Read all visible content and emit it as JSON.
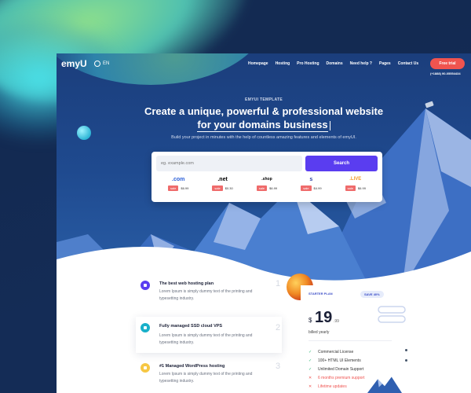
{
  "brand": {
    "logo": "emyU",
    "lang": "EN"
  },
  "nav": {
    "items": [
      "Homepage",
      "Hosting",
      "Pro Hosting",
      "Domains",
      "Need help ?",
      "Pages",
      "Contact Us"
    ],
    "cta": "Free trial",
    "phone": "(+1888) 90-05554434"
  },
  "hero": {
    "eyebrow": "EMYUI TEMPLATE",
    "title_line1": "Create a unique, powerful & professional website",
    "title_line2": "for your domains business",
    "subtitle": "Build your project in minutes with the help of countless amazing features and elements of emyUI."
  },
  "search": {
    "placeholder": "eg. example.com",
    "button": "Search",
    "tlds": [
      {
        "name": ".com",
        "sale": "sale",
        "price": "$6.99",
        "color": "#2b5fd9"
      },
      {
        "name": ".net",
        "sale": "sale",
        "price": "$0.30",
        "color": "#1a1f36"
      },
      {
        "name": ".shop",
        "sale": "sale",
        "price": "$6.99",
        "color": "#1a1f36"
      },
      {
        "name": "s",
        "sale": "sale",
        "price": "$4.99",
        "color": "#1a1f36"
      },
      {
        "name": ".LIVE",
        "sale": "sale",
        "price": "$6.99",
        "color": "#f29d2b"
      }
    ]
  },
  "features": [
    {
      "title": "The best web hosting plan",
      "desc": "Lorem Ipsum is simply dummy text of the printing and typesetting industry.",
      "num": "1",
      "color": "#5a3df0"
    },
    {
      "title": "Fully managed SSD cloud VPS",
      "desc": "Lorem Ipsum is simply dummy text of the printing and typesetting industry.",
      "num": "2",
      "color": "#19b0c9"
    },
    {
      "title": "#1 Managed WordPress hosting",
      "desc": "Lorem Ipsum is simply dummy text of the printing and typesetting industry.",
      "num": "3",
      "color": "#f6c744"
    }
  ],
  "pricing": {
    "plan": "STARTER PLAN",
    "save": "SAVE 40%",
    "currency": "$",
    "amount": "19",
    "cents": ".99",
    "billed": "billed yearly",
    "items": [
      {
        "text": "Commercial License",
        "check": "✓"
      },
      {
        "text": "100+ HTML UI Elements",
        "check": "✓"
      },
      {
        "text": "Unlimited Domain Support",
        "check": "✓"
      },
      {
        "text": "6 months premium support",
        "check": "✕"
      },
      {
        "text": "Lifetime updates",
        "check": "✕"
      }
    ]
  }
}
